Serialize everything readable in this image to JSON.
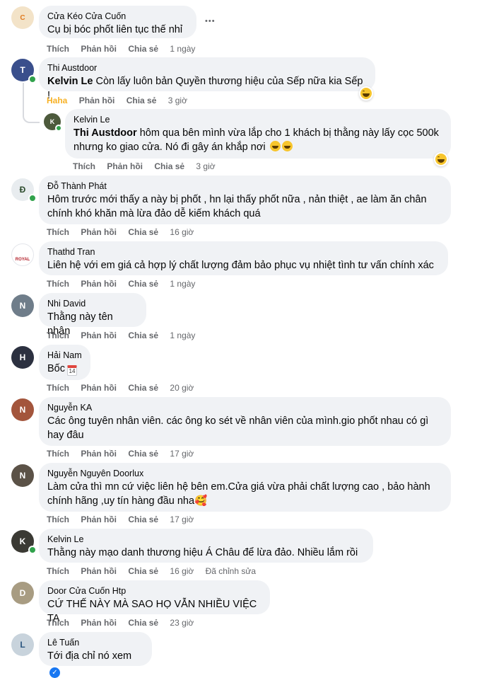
{
  "actions": {
    "like": "Thích",
    "reply": "Phản hồi",
    "share": "Chia sẻ",
    "haha": "Haha"
  },
  "comments": [
    {
      "author": "Cửa Kéo Cửa Cuốn",
      "text": "Cụ bị bóc phốt liên tục thế nhỉ",
      "time": "1 ngày",
      "more": "•••"
    },
    {
      "author": "Thi Austdoor",
      "mention": "Kelvin Le",
      "text": " Còn lấy luôn bản Quyền thương hiệu của Sếp nữa kia Sếp !",
      "time": "3 giờ"
    },
    {
      "author": "Kelvin Le",
      "mention": "Thi Austdoor",
      "text": " hôm qua bên mình vừa lắp cho 1 khách bị thằng này lấy cọc 500k nhưng ko giao cửa. Nó đi gây án khắp nơi",
      "time": "3 giờ"
    },
    {
      "author": "Đỗ Thành Phát",
      "text": "Hôm trước mới thấy a này bị phốt , hn lại thấy phốt nữa , nản thiệt , ae làm ăn chân chính khó khăn mà lừa đảo dễ kiếm khách quá",
      "time": "16 giờ"
    },
    {
      "author": "Thathd Tran",
      "text": "Liên hệ với em giá cả hợp lý chất lượng đảm bảo phục vụ nhiệt tình tư vấn chính xác",
      "time": "1 ngày",
      "avatar_text": "ROYAL"
    },
    {
      "author": "Nhi David",
      "text": "Thằng này tên nhân",
      "time": "1 ngày"
    },
    {
      "author": "Hải Nam",
      "text": "Bốc",
      "time": "20 giờ",
      "emoji": "14"
    },
    {
      "author": "Nguyễn KA",
      "text": "Các ông tuyên nhân viên. các ông ko sét về nhân viên của mình.gio phốt nhau có gì hay đâu",
      "time": "17 giờ"
    },
    {
      "author": "Nguyễn Nguyên Doorlux",
      "text": "Làm cửa thì mn cứ việc liên hệ bên em.Cửa giá vừa phải chất lượng cao , bảo hành chính hãng ,uy tín hàng đầu nha🥰",
      "time": "17 giờ"
    },
    {
      "author": "Kelvin Le",
      "text": "Thằng này mạo danh thương hiệu Á Châu để lừa đảo. Nhiều lắm rồi",
      "time": "16 giờ",
      "edited": "Đã chỉnh sửa"
    },
    {
      "author": "Door Cửa Cuốn Htp",
      "text": "CỨ THẾ NÀY MÀ SAO HỌ VẪN NHIỀU VIỆC TA",
      "time": "23 giờ"
    },
    {
      "author": "Lê Tuấn",
      "text": "Tới địa chỉ nó xem"
    }
  ],
  "colors": {
    "bubble": "#f0f2f5",
    "action_gray": "#65676b",
    "haha": "#f7b125",
    "online": "#31a24c"
  },
  "icons": {
    "haha_reaction": "haha-icon",
    "laugh_emoji": "laughing-emoji-icon",
    "calendar_emoji": "calendar-emoji-icon",
    "verified": "verified-badge-icon"
  }
}
